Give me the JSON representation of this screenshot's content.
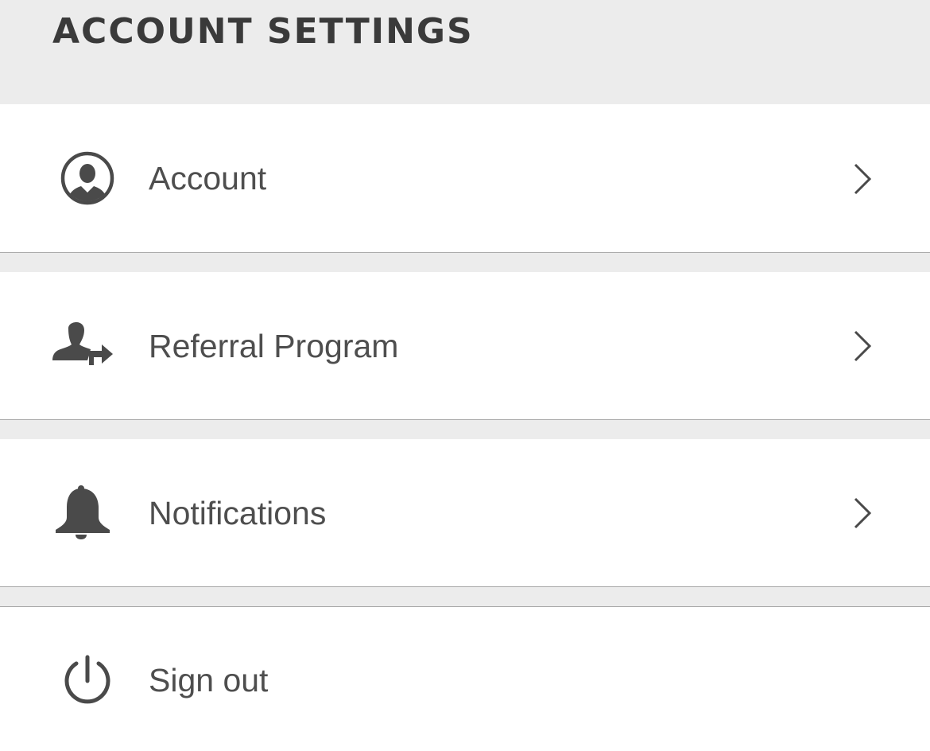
{
  "header": {
    "title": "ACCOUNT SETTINGS"
  },
  "menu": {
    "items": [
      {
        "label": "Account",
        "icon": "user-circle-icon",
        "has_chevron": true
      },
      {
        "label": "Referral Program",
        "icon": "user-referral-icon",
        "has_chevron": true
      },
      {
        "label": "Notifications",
        "icon": "bell-icon",
        "has_chevron": true
      },
      {
        "label": "Sign out",
        "icon": "power-icon",
        "has_chevron": false
      }
    ]
  },
  "colors": {
    "background": "#ececec",
    "row_background": "#ffffff",
    "text": "#4e4e4e",
    "icon": "#4a4a4a",
    "divider": "#a9a9a9"
  }
}
